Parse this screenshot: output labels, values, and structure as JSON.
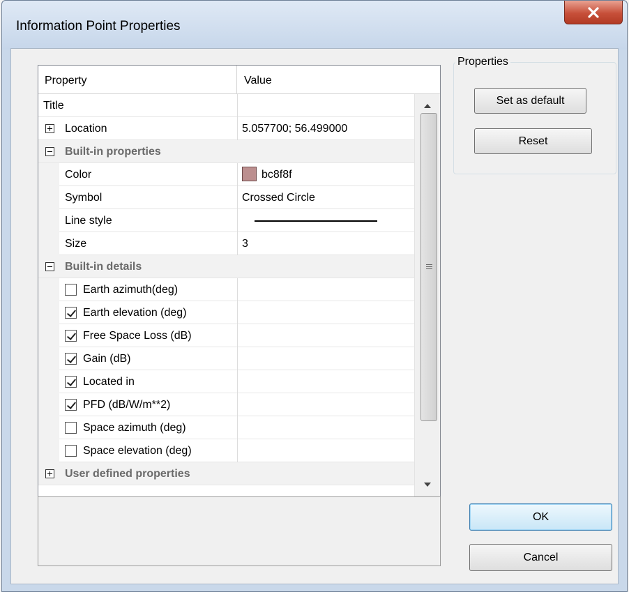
{
  "window": {
    "title": "Information Point Properties",
    "close_glyph": "X"
  },
  "grid": {
    "columns": {
      "property": "Property",
      "value": "Value"
    },
    "rows": {
      "title": {
        "label": "Title",
        "value": ""
      },
      "location": {
        "label": "Location",
        "value": "5.057700; 56.499000",
        "expanded": false
      },
      "builtin_properties": {
        "label": "Built-in properties",
        "expanded": true,
        "color": {
          "label": "Color",
          "value": "bc8f8f",
          "swatch": "#bc8f8f"
        },
        "symbol": {
          "label": "Symbol",
          "value": "Crossed Circle"
        },
        "line_style": {
          "label": "Line style",
          "value": "solid"
        },
        "size": {
          "label": "Size",
          "value": "3"
        }
      },
      "builtin_details": {
        "label": "Built-in details",
        "expanded": true,
        "items": [
          {
            "label": "Earth azimuth(deg)",
            "checked": false
          },
          {
            "label": "Earth elevation (deg)",
            "checked": true
          },
          {
            "label": "Free Space Loss (dB)",
            "checked": true
          },
          {
            "label": "Gain (dB)",
            "checked": true
          },
          {
            "label": "Located in",
            "checked": true
          },
          {
            "label": "PFD (dB/W/m**2)",
            "checked": true
          },
          {
            "label": "Space azimuth (deg)",
            "checked": false
          },
          {
            "label": "Space elevation (deg)",
            "checked": false
          }
        ]
      },
      "user_defined": {
        "label": "User defined properties",
        "expanded": false
      }
    }
  },
  "properties_group": {
    "label": "Properties",
    "set_default": "Set as default",
    "reset": "Reset"
  },
  "dialog_buttons": {
    "ok": "OK",
    "cancel": "Cancel"
  }
}
